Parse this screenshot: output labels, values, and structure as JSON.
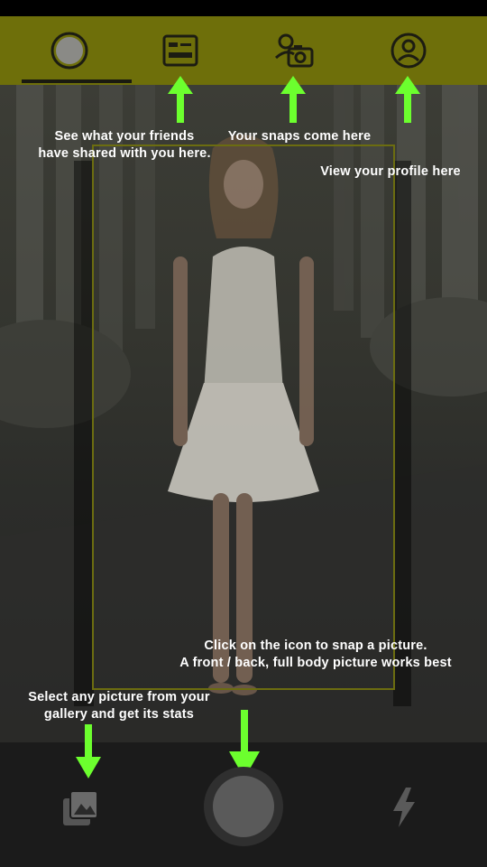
{
  "tabs": [
    {
      "id": "camera",
      "icon": "circle-icon",
      "selected": true
    },
    {
      "id": "feed",
      "icon": "feed-card-icon",
      "selected": false
    },
    {
      "id": "snaps",
      "icon": "user-camera-icon",
      "selected": false
    },
    {
      "id": "profile",
      "icon": "profile-icon",
      "selected": false
    }
  ],
  "hints": {
    "friends_feed": "See what your friends\nhave shared with you here.",
    "snaps": "Your snaps come here",
    "profile": "View your profile here",
    "snap_picture": "Click on the icon to snap a picture.\nA front / back, full body picture works best",
    "gallery": "Select any picture from your\ngallery and get its stats"
  },
  "colors": {
    "top_bar": "#6e6f0a",
    "guide_frame": "#6c6d10",
    "hint_arrow": "#6cff2e",
    "bottom_bar": "#1b1b1b"
  },
  "bottom_bar": {
    "gallery_icon": "gallery-icon",
    "shutter_icon": "shutter-button",
    "flash_icon": "flash-icon"
  }
}
